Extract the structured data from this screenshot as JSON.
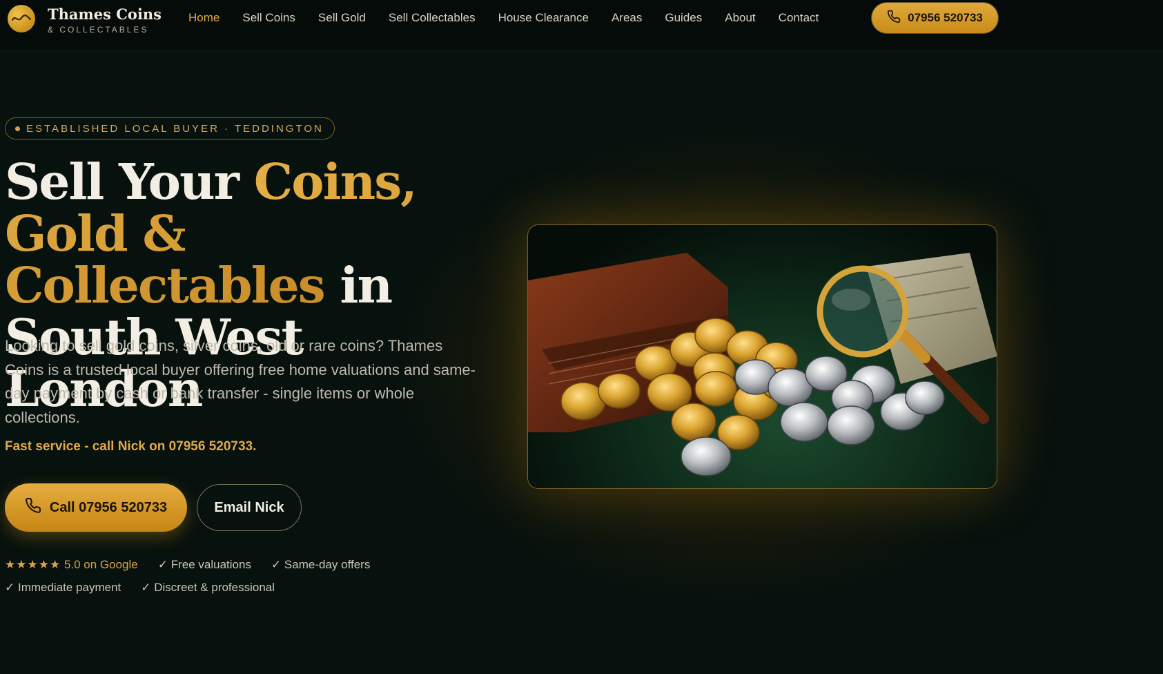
{
  "brand": {
    "name": "Thames Coins",
    "sub": "& COLLECTABLES",
    "logo_icon": "gold-coin-logo-icon"
  },
  "nav": {
    "items": [
      {
        "label": "Home",
        "active": true
      },
      {
        "label": "Sell Coins",
        "active": false
      },
      {
        "label": "Sell Gold",
        "active": false
      },
      {
        "label": "Sell Collectables",
        "active": false
      },
      {
        "label": "House Clearance",
        "active": false
      },
      {
        "label": "Areas",
        "active": false
      },
      {
        "label": "Guides",
        "active": false
      },
      {
        "label": "About",
        "active": false
      },
      {
        "label": "Contact",
        "active": false
      }
    ],
    "cta_label": "07956 520733",
    "cta_icon": "phone-icon"
  },
  "hero": {
    "badge": "ESTABLISHED LOCAL BUYER · TEDDINGTON",
    "title_part1": "Sell Your ",
    "title_gold": "Coins, Gold & Collectables",
    "title_part2": " in South West London",
    "description": "Looking to sell gold coins, silver coins, old or rare coins? Thames Coins is a trusted local buyer offering free home valuations and same-day payment by cash or bank transfer - single items or whole collections.",
    "fast_service": "Fast service - call Nick on 07956 520733.",
    "call_button": "Call 07956 520733",
    "email_button": "Email Nick",
    "trust": {
      "stars": "★★★★★",
      "rating": "5.0 on Google",
      "items_row1": [
        "✓ Free valuations",
        "✓ Same-day offers"
      ],
      "items_row2": [
        "✓ Immediate payment",
        "✓ Discreet & professional"
      ]
    }
  },
  "colors": {
    "accent": "#e2a948",
    "background": "#07110d",
    "text": "#f3eee3"
  }
}
